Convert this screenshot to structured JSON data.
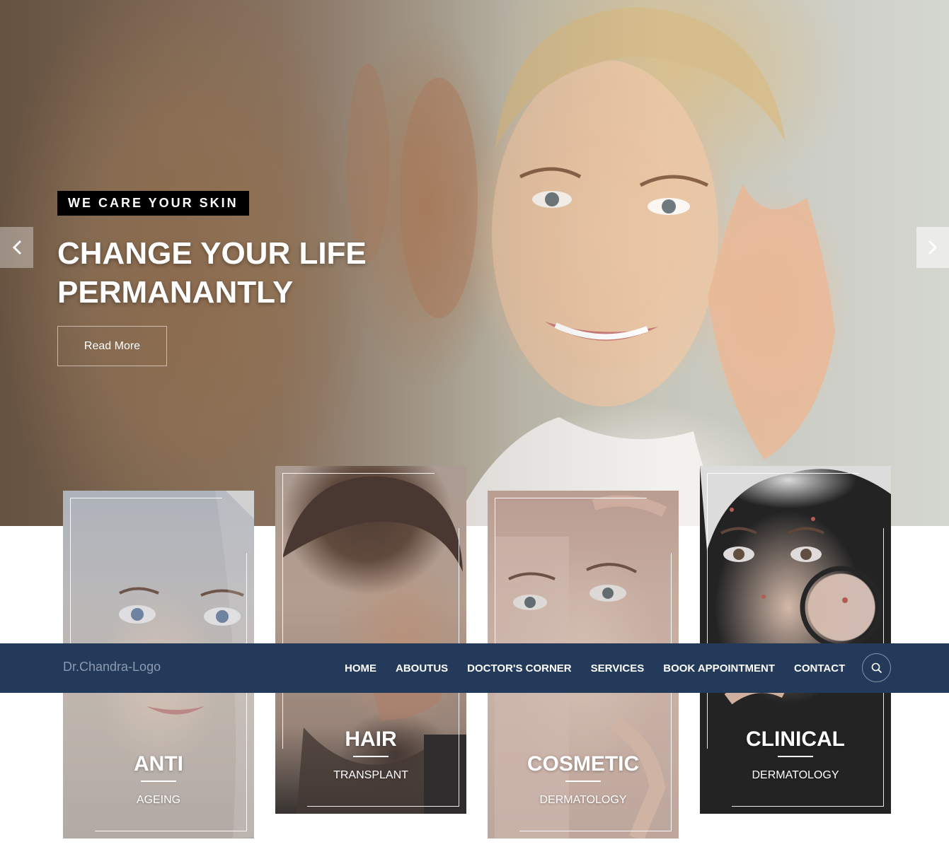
{
  "hero": {
    "tagline": "WE CARE YOUR SKIN",
    "headline_line1": "CHANGE YOUR LIFE",
    "headline_line2": "PERMANANTLY",
    "cta_label": "Read More",
    "prev_icon": "chevron-left-icon",
    "next_icon": "chevron-right-icon"
  },
  "services": [
    {
      "title": "ANTI",
      "subtitle": "AGEING"
    },
    {
      "title": "HAIR",
      "subtitle": "TRANSPLANT"
    },
    {
      "title": "COSMETIC",
      "subtitle": "DERMATOLOGY"
    },
    {
      "title": "CLINICAL",
      "subtitle": "DERMATOLOGY"
    }
  ],
  "nav": {
    "logo": "Dr.Chandra-Logo",
    "items": [
      {
        "label": "HOME"
      },
      {
        "label": "ABOUTUS"
      },
      {
        "label": "DOCTOR'S CORNER"
      },
      {
        "label": "SERVICES"
      },
      {
        "label": "BOOK APPOINTMENT"
      },
      {
        "label": "CONTACT"
      }
    ],
    "search_icon": "search-icon"
  },
  "colors": {
    "nav_background": "#233a5b",
    "tagline_background": "#000000",
    "text": "#ffffff"
  }
}
